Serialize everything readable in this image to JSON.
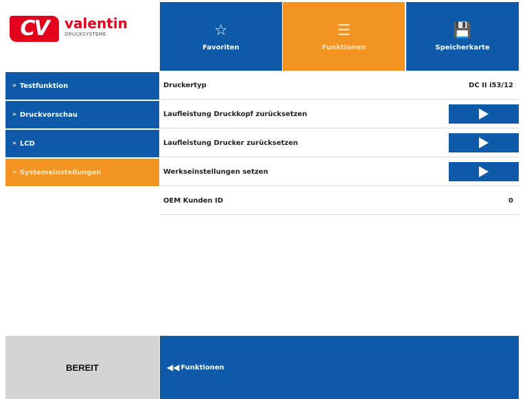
{
  "logo": {
    "mark": "CV",
    "name": "valentin",
    "sub": "DRUCKSYSTEME"
  },
  "tabs": [
    {
      "label": "Favoriten",
      "icon": "☆"
    },
    {
      "label": "Funktionen",
      "icon": "☰"
    },
    {
      "label": "Speicherkarte",
      "icon": "💾"
    }
  ],
  "sidebar": {
    "items": [
      {
        "label": "Testfunktion",
        "arrow": "»"
      },
      {
        "label": "Druckvorschau",
        "arrow": "»"
      },
      {
        "label": "LCD",
        "arrow": "»"
      },
      {
        "label": "Systemeinstellungen",
        "arrow": "»"
      }
    ]
  },
  "content": {
    "printer_type_label": "Druckertyp",
    "printer_type_value": "DC II i53/12",
    "reset_head_label": "Laufleistung Druckkopf zurücksetzen",
    "reset_printer_label": "Laufleistung Drucker zurücksetzen",
    "factory_label": "Werkseinstellungen setzen",
    "oem_label": "OEM Kunden ID",
    "oem_value": "0"
  },
  "status": {
    "text": "BEREIT"
  },
  "footer": {
    "back_arrow": "◀◀",
    "back_label": "Funktionen"
  },
  "colors": {
    "blue": "#0f5aa8",
    "orange": "#f39321",
    "red": "#e3001b",
    "status_gray": "#d4d4d4"
  }
}
